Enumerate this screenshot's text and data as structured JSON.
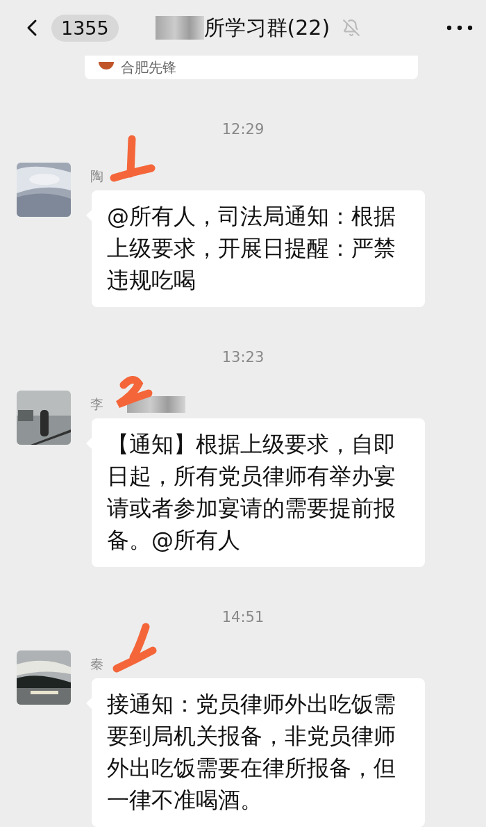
{
  "header": {
    "unread_count": "1355",
    "title": "所学习群(22)",
    "title_prefix_blurred": true,
    "muted": true
  },
  "top_card": {
    "source": "合肥先锋"
  },
  "messages": [
    {
      "time": "12:29",
      "sender": "陶",
      "sender_blurred": false,
      "text": "@所有人，司法局通知：根据上级要求，开展日提醒：严禁违规吃喝"
    },
    {
      "time": "13:23",
      "sender": "李",
      "sender_blurred": true,
      "text": "【通知】根据上级要求，自即日起，所有党员律师有举办宴请或者参加宴请的需要提前报备。@所有人"
    },
    {
      "time": "14:51",
      "sender": "秦",
      "sender_blurred": false,
      "text": "接通知：党员律师外出吃饭需要到局机关报备，非党员律师外出吃饭需要在律所报备，但一律不准喝酒。"
    }
  ]
}
